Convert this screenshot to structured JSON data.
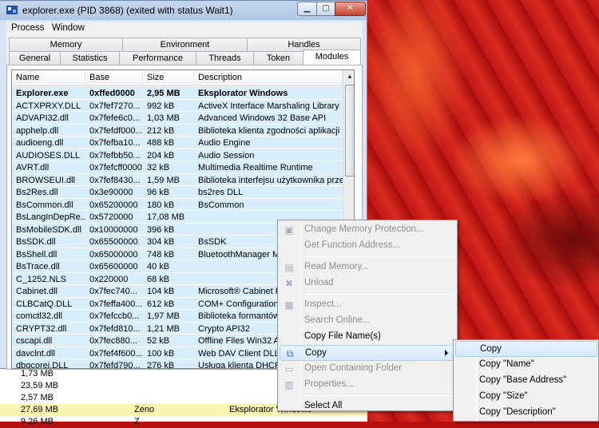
{
  "window": {
    "title": "explorer.exe (PID 3868) (exited with status Wait1)"
  },
  "menubar": [
    "Process",
    "Window"
  ],
  "tabs_row1": [
    "Memory",
    "Environment",
    "Handles"
  ],
  "tabs_row2": [
    "General",
    "Statistics",
    "Performance",
    "Threads",
    "Token",
    "Modules"
  ],
  "active_tab": "Modules",
  "columns": [
    "Name",
    "Base Address",
    "Size",
    "Description"
  ],
  "modules": [
    [
      "Explorer.exe",
      "0xffed0000",
      "2,95 MB",
      "Eksplorator Windows"
    ],
    [
      "ACTXPRXY.DLL",
      "0x7fef7270...",
      "992 kB",
      "ActiveX Interface Marshaling Library"
    ],
    [
      "ADVAPI32.dll",
      "0x7fefe6c0...",
      "1,03 MB",
      "Advanced Windows 32 Base API"
    ],
    [
      "apphelp.dll",
      "0x7fefdf000...",
      "212 kB",
      "Biblioteka klienta zgodności aplikacji"
    ],
    [
      "audioeng.dll",
      "0x7fefba10...",
      "488 kB",
      "Audio Engine"
    ],
    [
      "AUDIOSES.DLL",
      "0x7fefbb50...",
      "204 kB",
      "Audio Session"
    ],
    [
      "AVRT.dll",
      "0x7fefcff0000",
      "32 kB",
      "Multimedia Realtime Runtime"
    ],
    [
      "BROWSEUI.dll",
      "0x7fef8430...",
      "1,59 MB",
      "Biblioteka interfejsu użytkownika prze..."
    ],
    [
      "Bs2Res.dll",
      "0x3e90000",
      "96 kB",
      "bs2res DLL"
    ],
    [
      "BsCommon.dll",
      "0x65200000",
      "180 kB",
      "BsCommon"
    ],
    [
      "BsLangInDepRe...",
      "0x5720000",
      "17,08 MB",
      ""
    ],
    [
      "BsMobileSDK.dll",
      "0x10000000",
      "396 kB",
      ""
    ],
    [
      "BsSDK.dll",
      "0x65500000",
      "304 kB",
      "BsSDK"
    ],
    [
      "BsShell.dll",
      "0x65000000",
      "748 kB",
      "BluetoothManager Mod"
    ],
    [
      "BsTrace.dll",
      "0x65600000",
      "40 kB",
      ""
    ],
    [
      "C_1252.NLS",
      "0x220000",
      "68 kB",
      ""
    ],
    [
      "Cabinet.dll",
      "0x7fec740...",
      "104 kB",
      "Microsoft® Cabinet File"
    ],
    [
      "CLBCatQ.DLL",
      "0x7feffa400...",
      "612 kB",
      "COM+ Configuration Cat"
    ],
    [
      "comctl32.dll",
      "0x7fefccb0...",
      "1,97 MB",
      "Biblioteka formantów cz"
    ],
    [
      "CRYPT32.dll",
      "0x7fefd810...",
      "1,21 MB",
      "Crypto API32"
    ],
    [
      "cscapi.dll",
      "0x7fec880...",
      "52 kB",
      "Offline Files Win32 API"
    ],
    [
      "davclnt.dll",
      "0x7fef4f600...",
      "100 kB",
      "Web DAV Client DLL"
    ],
    [
      "dbgcorej.DLL",
      "0x7fefd790...",
      "276 kB",
      "Usługa klienta DHCP"
    ]
  ],
  "context_menu": {
    "items": [
      {
        "label": "Change Memory Protection...",
        "disabled": true,
        "icon": "shield-icon"
      },
      {
        "label": "Get Function Address...",
        "disabled": true,
        "icon": ""
      },
      {
        "sep": true
      },
      {
        "label": "Read Memory...",
        "disabled": true,
        "icon": "memory-icon"
      },
      {
        "label": "Unload",
        "disabled": true,
        "icon": "cross-icon"
      },
      {
        "sep": true
      },
      {
        "label": "Inspect...",
        "disabled": true,
        "icon": "inspect-icon"
      },
      {
        "label": "Search Online...",
        "disabled": true,
        "icon": ""
      },
      {
        "label": "Copy File Name(s)",
        "disabled": false,
        "icon": ""
      },
      {
        "label": "Copy",
        "disabled": false,
        "icon": "copy-icon",
        "submenu": true,
        "hot": true
      },
      {
        "label": "Open Containing Folder",
        "disabled": true,
        "icon": "folder-icon"
      },
      {
        "label": "Properties...",
        "disabled": true,
        "icon": "properties-icon"
      },
      {
        "sep": true
      },
      {
        "label": "Select All",
        "disabled": false,
        "icon": ""
      }
    ]
  },
  "copy_submenu": [
    "Copy",
    "Copy \"Name\"",
    "Copy \"Base Address\"",
    "Copy \"Size\"",
    "Copy \"Description\""
  ],
  "background_list": [
    [
      "1,73 MB",
      "",
      ""
    ],
    [
      "23,59 MB",
      "",
      ""
    ],
    [
      "2,57 MB",
      "",
      ""
    ],
    [
      "27,69 MB",
      "Zeno",
      "Eksplorator Windows"
    ],
    [
      "9,26 MB",
      "Z",
      ""
    ]
  ]
}
